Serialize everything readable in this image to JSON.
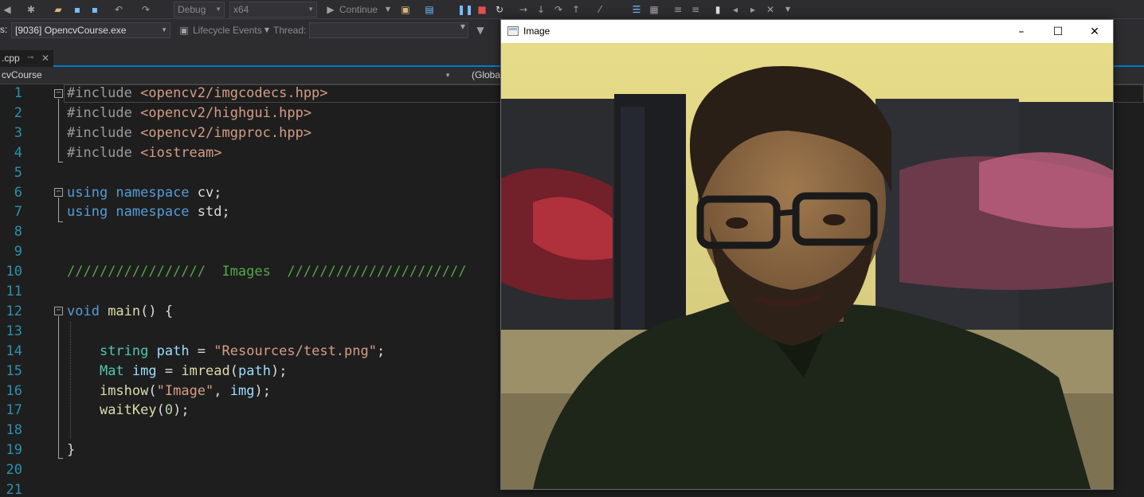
{
  "toolbar": {
    "config": "Debug",
    "platform": "x64",
    "continue": "Continue"
  },
  "debug_bar": {
    "process_label": "s:",
    "process": "[9036] OpencvCourse.exe",
    "lifecycle": "Lifecycle Events",
    "thread_label": "Thread:",
    "thread": ""
  },
  "tabs": [
    {
      "label": ".cpp"
    }
  ],
  "nav": {
    "project": "cvCourse",
    "scope": "(Globa"
  },
  "editor": {
    "lines": [
      {
        "n": "1",
        "tokens": [
          [
            "c-pre",
            "#include "
          ],
          [
            "c-str",
            "<opencv2/imgcodecs.hpp>"
          ]
        ]
      },
      {
        "n": "2",
        "tokens": [
          [
            "c-pre",
            "#include "
          ],
          [
            "c-str",
            "<opencv2/highgui.hpp>"
          ]
        ]
      },
      {
        "n": "3",
        "tokens": [
          [
            "c-pre",
            "#include "
          ],
          [
            "c-str",
            "<opencv2/imgproc.hpp>"
          ]
        ]
      },
      {
        "n": "4",
        "tokens": [
          [
            "c-pre",
            "#include "
          ],
          [
            "c-str",
            "<iostream>"
          ]
        ]
      },
      {
        "n": "5",
        "tokens": []
      },
      {
        "n": "6",
        "tokens": [
          [
            "c-kw",
            "using "
          ],
          [
            "c-kw",
            "namespace "
          ],
          [
            "c-plain",
            "cv;"
          ]
        ]
      },
      {
        "n": "7",
        "tokens": [
          [
            "c-kw",
            "using "
          ],
          [
            "c-kw",
            "namespace "
          ],
          [
            "c-plain",
            "std;"
          ]
        ]
      },
      {
        "n": "8",
        "tokens": []
      },
      {
        "n": "9",
        "tokens": []
      },
      {
        "n": "10",
        "tokens": [
          [
            "c-com",
            "/////////////////  Images  //////////////////////"
          ]
        ]
      },
      {
        "n": "11",
        "tokens": []
      },
      {
        "n": "12",
        "tokens": [
          [
            "c-kw",
            "void "
          ],
          [
            "c-fn",
            "main"
          ],
          [
            "c-plain",
            "() {"
          ]
        ]
      },
      {
        "n": "13",
        "tokens": []
      },
      {
        "n": "14",
        "tokens": [
          [
            "c-plain",
            "    "
          ],
          [
            "c-type",
            "string "
          ],
          [
            "c-var",
            "path"
          ],
          [
            "c-plain",
            " = "
          ],
          [
            "c-str",
            "\"Resources/test.png\""
          ],
          [
            "c-plain",
            ";"
          ]
        ]
      },
      {
        "n": "15",
        "tokens": [
          [
            "c-plain",
            "    "
          ],
          [
            "c-type",
            "Mat "
          ],
          [
            "c-var",
            "img"
          ],
          [
            "c-plain",
            " = "
          ],
          [
            "c-fn",
            "imread"
          ],
          [
            "c-plain",
            "("
          ],
          [
            "c-var",
            "path"
          ],
          [
            "c-plain",
            ");"
          ]
        ]
      },
      {
        "n": "16",
        "tokens": [
          [
            "c-plain",
            "    "
          ],
          [
            "c-fn",
            "imshow"
          ],
          [
            "c-plain",
            "("
          ],
          [
            "c-str",
            "\"Image\""
          ],
          [
            "c-plain",
            ", "
          ],
          [
            "c-var",
            "img"
          ],
          [
            "c-plain",
            ");"
          ]
        ]
      },
      {
        "n": "17",
        "tokens": [
          [
            "c-plain",
            "    "
          ],
          [
            "c-fn",
            "waitKey"
          ],
          [
            "c-plain",
            "("
          ],
          [
            "c-num",
            "0"
          ],
          [
            "c-plain",
            ");"
          ]
        ]
      },
      {
        "n": "18",
        "tokens": []
      },
      {
        "n": "19",
        "tokens": [
          [
            "c-plain",
            "}"
          ]
        ]
      },
      {
        "n": "20",
        "tokens": []
      },
      {
        "n": "21",
        "tokens": []
      }
    ]
  },
  "image_window": {
    "title": "Image",
    "minimize": "–",
    "maximize": "☐",
    "close": "✕"
  },
  "icons": {
    "fold_open": "−"
  }
}
